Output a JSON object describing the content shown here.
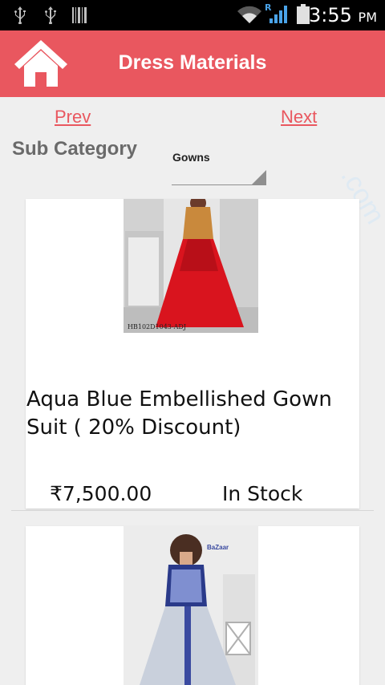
{
  "status_bar": {
    "time": "3:55",
    "ampm": "PM",
    "icons": [
      "usb-icon",
      "usb-icon",
      "barcode-icon",
      "wifi-icon",
      "signal-icon",
      "battery-icon"
    ],
    "signal_badge": "R"
  },
  "header": {
    "title": "Dress Materials",
    "background_color": "#e9575f",
    "home_icon": "home-icon"
  },
  "nav": {
    "prev_label": "Prev",
    "next_label": "Next"
  },
  "filter": {
    "label": "Sub Category",
    "selected": "Gowns"
  },
  "products": [
    {
      "title": "Aqua Blue Embellished Gown Suit ( 20% Discount)",
      "price": "₹7,500.00",
      "stock": "In Stock",
      "image_caption": "HB102D1043-ADJ"
    },
    {
      "image_brand": "BaZaar"
    }
  ]
}
